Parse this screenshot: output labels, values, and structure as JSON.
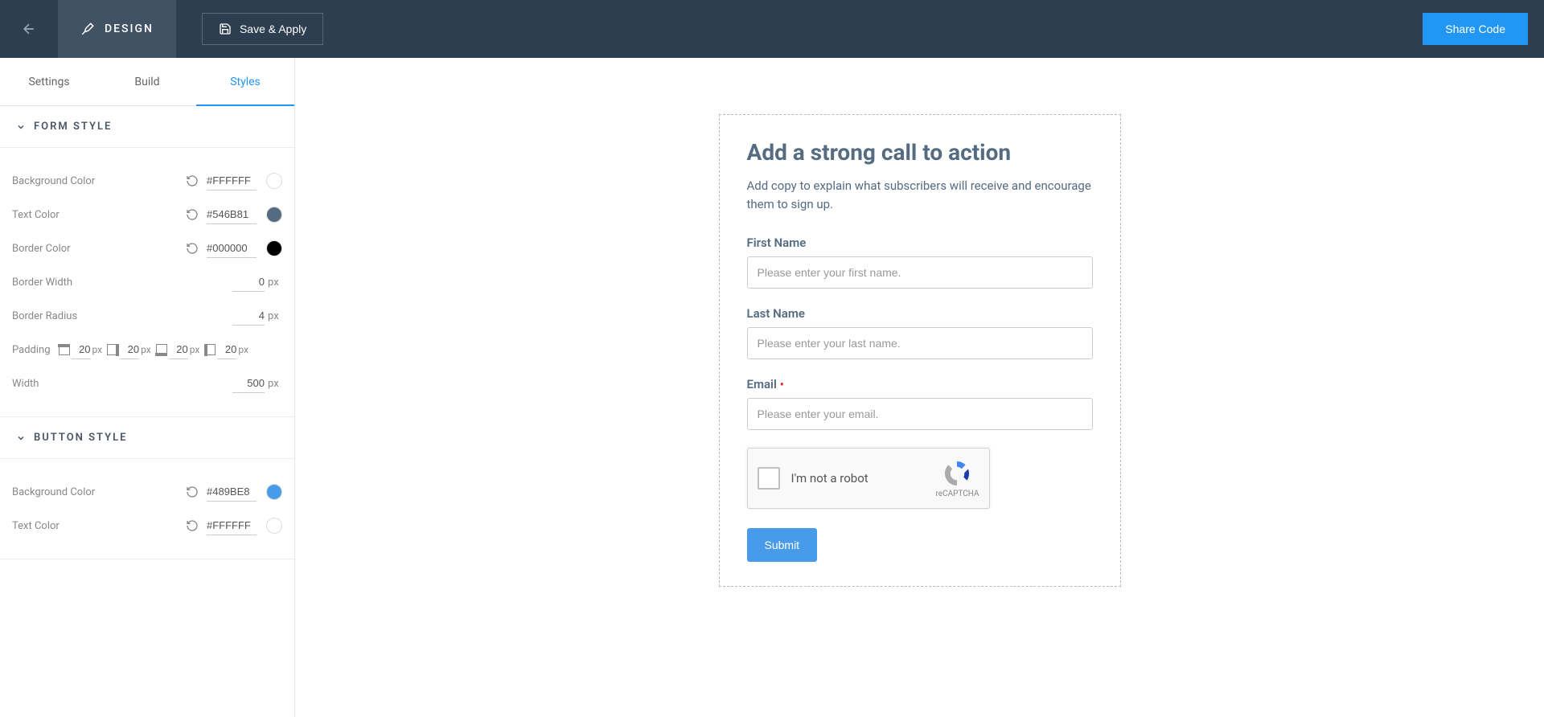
{
  "topbar": {
    "design_label": "DESIGN",
    "save_label": "Save & Apply",
    "share_label": "Share Code"
  },
  "tabs": {
    "settings": "Settings",
    "build": "Build",
    "styles": "Styles"
  },
  "sections": {
    "form_style": "FORM STYLE",
    "button_style": "BUTTON STYLE"
  },
  "form_style": {
    "bg_label": "Background Color",
    "bg_value": "#FFFFFF",
    "bg_swatch": "#FFFFFF",
    "text_label": "Text Color",
    "text_value": "#546B81",
    "text_swatch": "#546B81",
    "border_label": "Border Color",
    "border_value": "#000000",
    "border_swatch": "#000000",
    "border_width_label": "Border Width",
    "border_width_value": "0",
    "border_radius_label": "Border Radius",
    "border_radius_value": "4",
    "padding_label": "Padding",
    "padding_top": "20",
    "padding_right": "20",
    "padding_bottom": "20",
    "padding_left": "20",
    "width_label": "Width",
    "width_value": "500",
    "unit_px": "px"
  },
  "button_style": {
    "bg_label": "Background Color",
    "bg_value": "#489BE8",
    "bg_swatch": "#489BE8",
    "text_label": "Text Color",
    "text_value": "#FFFFFF",
    "text_swatch": "#FFFFFF"
  },
  "preview": {
    "title": "Add a strong call to action",
    "desc": "Add copy to explain what subscribers will receive and encourage them to sign up.",
    "first_name_label": "First Name",
    "first_name_ph": "Please enter your first name.",
    "last_name_label": "Last Name",
    "last_name_ph": "Please enter your last name.",
    "email_label": "Email",
    "email_ph": "Please enter your email.",
    "recaptcha_text": "I'm not a robot",
    "recaptcha_brand": "reCAPTCHA",
    "submit_label": "Submit"
  }
}
